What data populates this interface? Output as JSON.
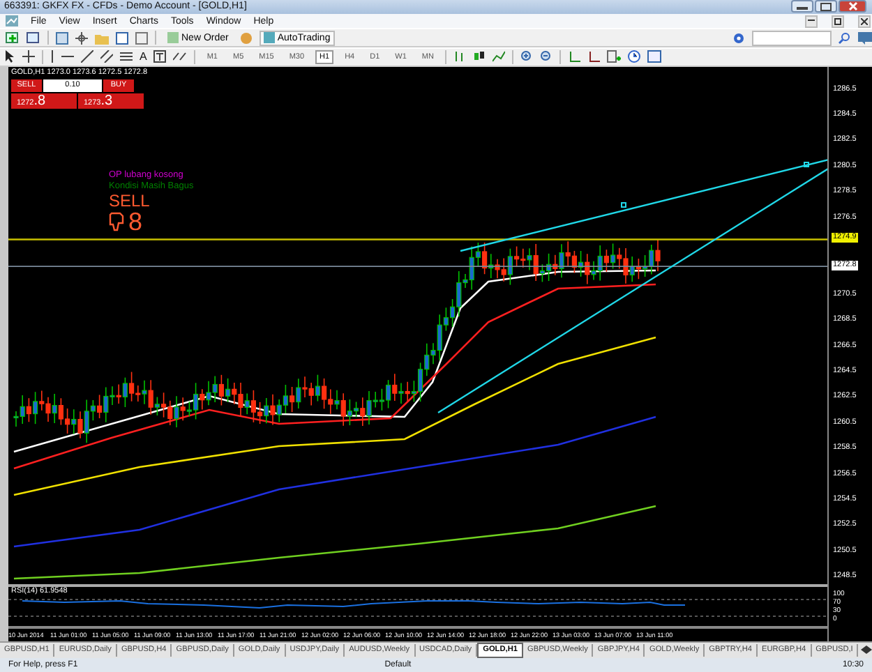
{
  "window": {
    "title": "663391: GKFX FX - CFDs - Demo Account - [GOLD,H1]"
  },
  "menu": [
    "File",
    "View",
    "Insert",
    "Charts",
    "Tools",
    "Window",
    "Help"
  ],
  "toolbar": {
    "new_order": "New Order",
    "autotrading": "AutoTrading",
    "text_tool": "A"
  },
  "timeframes": [
    {
      "label": "M1",
      "selected": false
    },
    {
      "label": "M5",
      "selected": false
    },
    {
      "label": "M15",
      "selected": false
    },
    {
      "label": "M30",
      "selected": false
    },
    {
      "label": "H1",
      "selected": true
    },
    {
      "label": "H4",
      "selected": false
    },
    {
      "label": "D1",
      "selected": false
    },
    {
      "label": "W1",
      "selected": false
    },
    {
      "label": "MN",
      "selected": false
    }
  ],
  "chart": {
    "header": "GOLD,H1 1273.0 1273.6 1272.5 1272.8",
    "trade_panel": {
      "sell": "SELL",
      "lot": "0.10",
      "buy": "BUY",
      "bid_main": "1272",
      "bid_big": ".8",
      "ask_main": "1273",
      "ask_big": ".3"
    },
    "signals": [
      {
        "text": "OP lubang kosong",
        "color": "#d000d0"
      },
      {
        "text": "Kondisi Masih Bagus",
        "color": "#008000"
      }
    ],
    "signal": "SELL",
    "digit": "8",
    "price_axis": [
      {
        "text": "1286.5",
        "kind": "tick"
      },
      {
        "text": "1284.5",
        "kind": "tick"
      },
      {
        "text": "1282.5",
        "kind": "tick"
      },
      {
        "text": "1280.5",
        "kind": "tick"
      },
      {
        "text": "1278.5",
        "kind": "tick"
      },
      {
        "text": "1276.5",
        "kind": "tick"
      },
      {
        "text": "1274.9",
        "kind": "line"
      },
      {
        "text": "1272.8",
        "kind": "bid"
      },
      {
        "text": "1270.5",
        "kind": "tick"
      },
      {
        "text": "1268.5",
        "kind": "tick"
      },
      {
        "text": "1266.5",
        "kind": "tick"
      },
      {
        "text": "1264.5",
        "kind": "tick"
      },
      {
        "text": "1262.5",
        "kind": "tick"
      },
      {
        "text": "1260.5",
        "kind": "tick"
      },
      {
        "text": "1258.5",
        "kind": "tick"
      },
      {
        "text": "1256.5",
        "kind": "tick"
      },
      {
        "text": "1254.5",
        "kind": "tick"
      },
      {
        "text": "1252.5",
        "kind": "tick"
      },
      {
        "text": "1250.5",
        "kind": "tick"
      },
      {
        "text": "1248.5",
        "kind": "tick"
      }
    ],
    "rsi": {
      "label": "RSI(14) 61.9548",
      "levels": [
        "100",
        "70",
        "30",
        "0"
      ]
    },
    "time_labels": [
      "10 Jun 2014",
      "11 Jun 01:00",
      "11 Jun 05:00",
      "11 Jun 09:00",
      "11 Jun 13:00",
      "11 Jun 17:00",
      "11 Jun 21:00",
      "12 Jun 02:00",
      "12 Jun 06:00",
      "12 Jun 10:00",
      "12 Jun 14:00",
      "12 Jun 18:00",
      "12 Jun 22:00",
      "13 Jun 03:00",
      "13 Jun 07:00",
      "13 Jun 11:00"
    ]
  },
  "tabs": [
    {
      "label": "GBPUSD,H1",
      "selected": false
    },
    {
      "label": "EURUSD,Daily",
      "selected": false
    },
    {
      "label": "GBPUSD,H4",
      "selected": false
    },
    {
      "label": "GBPUSD,Daily",
      "selected": false
    },
    {
      "label": "GOLD,Daily",
      "selected": false
    },
    {
      "label": "USDJPY,Daily",
      "selected": false
    },
    {
      "label": "AUDUSD,Weekly",
      "selected": false
    },
    {
      "label": "USDCAD,Daily",
      "selected": false
    },
    {
      "label": "GOLD,H1",
      "selected": true
    },
    {
      "label": "GBPUSD,Weekly",
      "selected": false
    },
    {
      "label": "GBPJPY,H4",
      "selected": false
    },
    {
      "label": "GOLD,Weekly",
      "selected": false
    },
    {
      "label": "GBPTRY,H4",
      "selected": false
    },
    {
      "label": "EURGBP,H4",
      "selected": false
    },
    {
      "label": "GBPUSD,I",
      "selected": false
    }
  ],
  "status_bar": {
    "help": "For Help, press F1",
    "profile": "Default",
    "clock": "10:30"
  }
}
